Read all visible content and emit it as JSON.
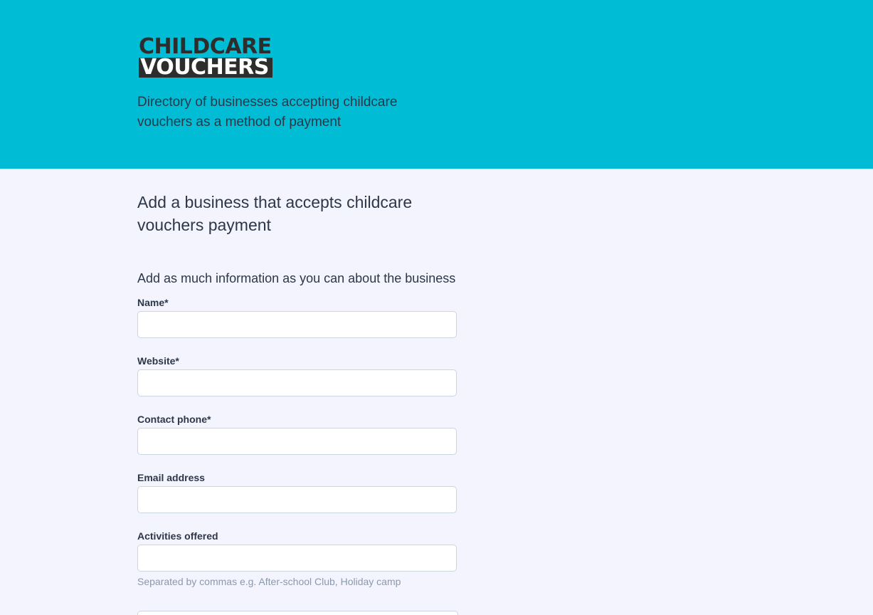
{
  "logo": {
    "line1": "CHILDCARE",
    "line2": "VOUCHERS"
  },
  "header": {
    "tagline": "Directory of businesses accepting childcare vouchers as a method of payment"
  },
  "main": {
    "title": "Add a business that accepts childcare vouchers payment",
    "intro": "Add as much information as you can about the business"
  },
  "form": {
    "fields": [
      {
        "label": "Name*",
        "value": "",
        "help": ""
      },
      {
        "label": "Website*",
        "value": "",
        "help": ""
      },
      {
        "label": "Contact phone*",
        "value": "",
        "help": ""
      },
      {
        "label": "Email address",
        "value": "",
        "help": ""
      },
      {
        "label": "Activities offered",
        "value": "",
        "help": "Separated by commas e.g. After-school Club, Holiday camp"
      }
    ]
  },
  "colors": {
    "header_bg": "#00bcd4",
    "page_bg": "#f3f4fe",
    "text": "#2d3748",
    "help_text": "#8a99ad",
    "input_border": "#cbd5e0"
  }
}
